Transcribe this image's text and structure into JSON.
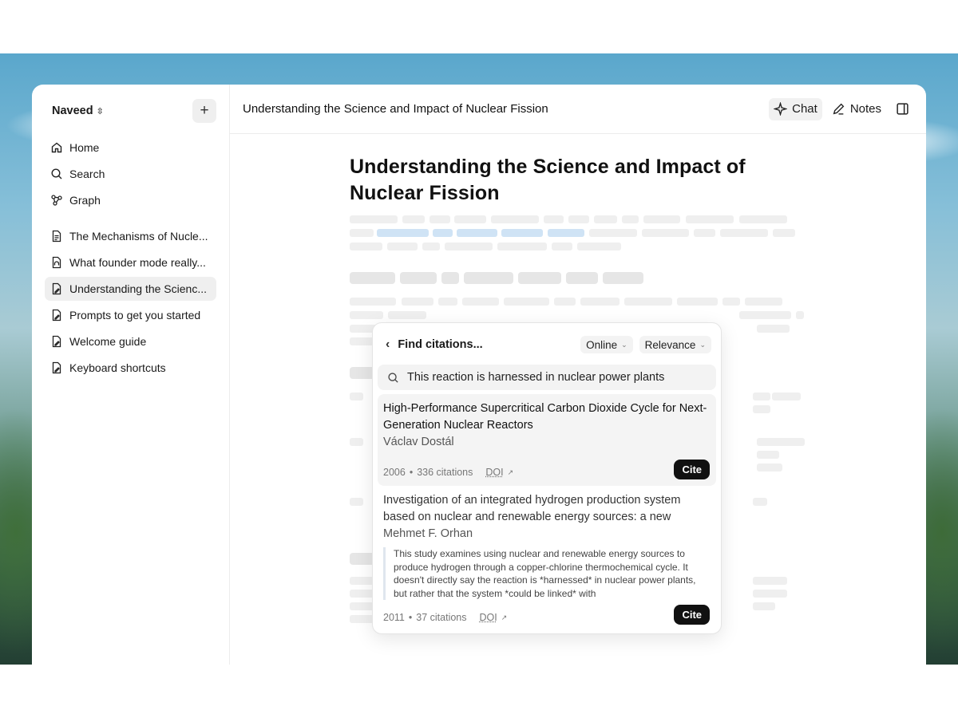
{
  "sidebar": {
    "user_name": "Naveed",
    "nav": [
      {
        "label": "Home",
        "icon": "home-icon"
      },
      {
        "label": "Search",
        "icon": "search-icon"
      },
      {
        "label": "Graph",
        "icon": "graph-icon"
      }
    ],
    "docs": [
      {
        "label": "The Mechanisms of Nucle..."
      },
      {
        "label": "What founder mode really..."
      },
      {
        "label": "Understanding the Scienc..."
      },
      {
        "label": "Prompts to get you started"
      },
      {
        "label": "Welcome guide"
      },
      {
        "label": "Keyboard shortcuts"
      }
    ]
  },
  "header": {
    "title": "Understanding the Science and Impact of Nuclear Fission",
    "chat_label": "Chat",
    "notes_label": "Notes"
  },
  "document": {
    "heading": "Understanding the Science and Impact of Nuclear Fission"
  },
  "citations": {
    "title": "Find citations...",
    "source_filter": "Online",
    "sort_filter": "Relevance",
    "query": "This reaction is harnessed in nuclear power plants",
    "results": [
      {
        "title": "High-Performance Supercritical Carbon Dioxide Cycle for Next-Generation Nuclear Reactors",
        "author": "Václav Dostál",
        "year": "2006",
        "citations": "336 citations",
        "doi": "DOI",
        "cite_label": "Cite"
      },
      {
        "title": "Investigation of an integrated hydrogen production system based on nuclear and renewable energy sources: a new",
        "author": "Mehmet F. Orhan",
        "excerpt": "This study examines using nuclear and renewable energy sources to produce hydrogen through a copper-chlorine thermochemical cycle. It doesn't directly say the reaction is *harnessed* in nuclear power plants, but rather that the system *could be linked* with",
        "year": "2011",
        "citations": "37 citations",
        "doi": "DOI",
        "cite_label": "Cite"
      }
    ]
  }
}
